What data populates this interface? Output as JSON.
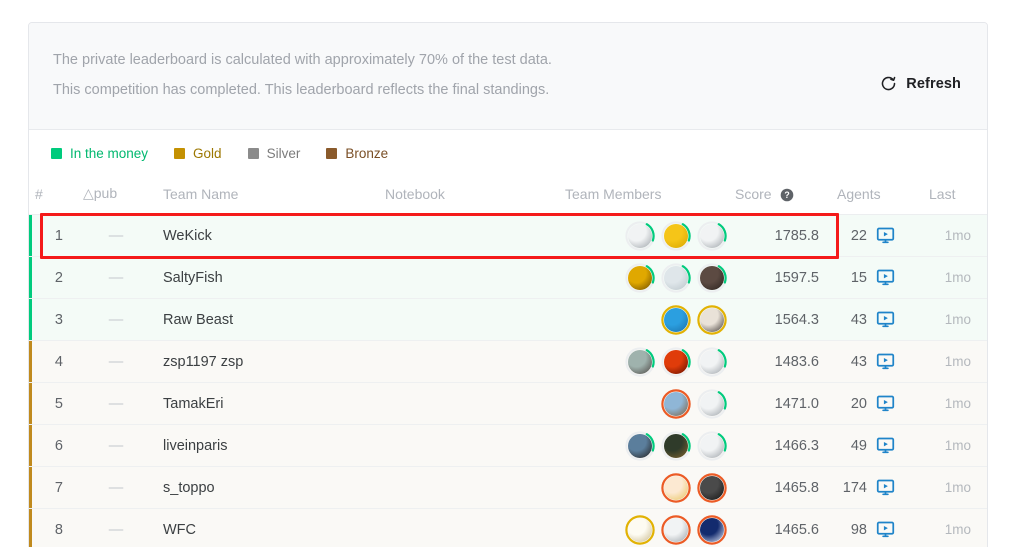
{
  "banner": {
    "line1": "The private leaderboard is calculated with approximately 70% of the test data.",
    "line2": "This competition has completed. This leaderboard reflects the final standings.",
    "refresh_label": "Refresh",
    "refresh_icon": "refresh-icon"
  },
  "legend": {
    "items": [
      {
        "label": "In the money",
        "color": "#00cb7d",
        "text_color": "#00b86f"
      },
      {
        "label": "Gold",
        "color": "#c49102",
        "text_color": "#9c7700"
      },
      {
        "label": "Silver",
        "color": "#8b8b8b",
        "text_color": "#7b7b7b"
      },
      {
        "label": "Bronze",
        "color": "#8a5a2b",
        "text_color": "#7a4f26"
      }
    ]
  },
  "table": {
    "headers": {
      "rank": "#",
      "delta": "△pub",
      "team": "Team Name",
      "notebook": "Notebook",
      "members": "Team Members",
      "score": "Score",
      "score_help_icon": "help-circle-icon",
      "agents": "Agents",
      "last": "Last"
    },
    "rows": [
      {
        "rank": "1",
        "delta": "—",
        "team": "WeKick",
        "notebook": "",
        "score": "1785.8",
        "agents": "22",
        "last": "1mo",
        "tier": "money",
        "stripe": "#00cb7d",
        "highlighted": true,
        "members": [
          {
            "ring": "#00cb7d",
            "arc": 0.22,
            "face_a": "#f1f3f4",
            "face_b": "#9aa0a6",
            "kind": "goose"
          },
          {
            "ring": "#00cb7d",
            "arc": 0.22,
            "face_a": "#f5c518",
            "face_b": "#d6a400",
            "kind": "pikachu"
          },
          {
            "ring": "#00cb7d",
            "arc": 0.22,
            "face_a": "#f1f3f4",
            "face_b": "#9aa0a6",
            "kind": "goose"
          }
        ]
      },
      {
        "rank": "2",
        "delta": "—",
        "team": "SaltyFish",
        "notebook": "",
        "score": "1597.5",
        "agents": "15",
        "last": "1mo",
        "tier": "money",
        "stripe": "#00cb7d",
        "highlighted": false,
        "members": [
          {
            "ring": "#00cb7d",
            "arc": 0.22,
            "face_a": "#e0a800",
            "face_b": "#6b4a00",
            "kind": "bottle"
          },
          {
            "ring": "#00cb7d",
            "arc": 0.22,
            "face_a": "#dfe6ea",
            "face_b": "#b9c4c9",
            "kind": "bird"
          },
          {
            "ring": "#00cb7d",
            "arc": 0.22,
            "face_a": "#5c4a42",
            "face_b": "#2a211d",
            "kind": "photo"
          }
        ]
      },
      {
        "rank": "3",
        "delta": "—",
        "team": "Raw Beast",
        "notebook": "",
        "score": "1564.3",
        "agents": "43",
        "last": "1mo",
        "tier": "money",
        "stripe": "#00cb7d",
        "highlighted": false,
        "members": [
          {
            "ring": "#e2b203",
            "arc": 1.0,
            "face_a": "#2b9fe0",
            "face_b": "#1b6fa8",
            "kind": "person"
          },
          {
            "ring": "#e2b203",
            "arc": 1.0,
            "face_a": "#e9e2d8",
            "face_b": "#3a3330",
            "kind": "person2"
          }
        ]
      },
      {
        "rank": "4",
        "delta": "—",
        "team": "zsp1197 zsp",
        "notebook": "",
        "score": "1483.6",
        "agents": "43",
        "last": "1mo",
        "tier": "gold",
        "stripe": "#c08a1e",
        "highlighted": false,
        "members": [
          {
            "ring": "#00cb7d",
            "arc": 0.22,
            "face_a": "#9fb2ad",
            "face_b": "#4a4340",
            "kind": "cat"
          },
          {
            "ring": "#00cb7d",
            "arc": 0.22,
            "face_a": "#e03c0a",
            "face_b": "#5c0d00",
            "kind": "fire"
          },
          {
            "ring": "#00cb7d",
            "arc": 0.22,
            "face_a": "#f1f3f4",
            "face_b": "#9aa0a6",
            "kind": "goose"
          }
        ]
      },
      {
        "rank": "5",
        "delta": "—",
        "team": "TamakEri",
        "notebook": "",
        "score": "1471.0",
        "agents": "20",
        "last": "1mo",
        "tier": "gold",
        "stripe": "#c08a1e",
        "highlighted": false,
        "members": [
          {
            "ring": "#ec5b25",
            "arc": 1.0,
            "face_a": "#8fb6d6",
            "face_b": "#7a5c3a",
            "kind": "scene"
          },
          {
            "ring": "#00cb7d",
            "arc": 0.22,
            "face_a": "#f1f3f4",
            "face_b": "#9aa0a6",
            "kind": "goose"
          }
        ]
      },
      {
        "rank": "6",
        "delta": "—",
        "team": "liveinparis",
        "notebook": "",
        "score": "1466.3",
        "agents": "49",
        "last": "1mo",
        "tier": "gold",
        "stripe": "#c08a1e",
        "highlighted": false,
        "members": [
          {
            "ring": "#00cb7d",
            "arc": 0.22,
            "face_a": "#5b7e9c",
            "face_b": "#1e1a18",
            "kind": "portrait"
          },
          {
            "ring": "#00cb7d",
            "arc": 0.22,
            "face_a": "#2f3b2a",
            "face_b": "#86662e",
            "kind": "scene2"
          },
          {
            "ring": "#00cb7d",
            "arc": 0.22,
            "face_a": "#f1f3f4",
            "face_b": "#9aa0a6",
            "kind": "goose"
          }
        ]
      },
      {
        "rank": "7",
        "delta": "—",
        "team": "s_toppo",
        "notebook": "",
        "score": "1465.8",
        "agents": "174",
        "last": "1mo",
        "tier": "gold",
        "stripe": "#c08a1e",
        "highlighted": false,
        "members": [
          {
            "ring": "#ec5b25",
            "arc": 1.0,
            "face_a": "#fce9d2",
            "face_b": "#e8c35a",
            "kind": "anime"
          },
          {
            "ring": "#ec5b25",
            "arc": 1.0,
            "face_a": "#4a4a4a",
            "face_b": "#111111",
            "kind": "dark"
          }
        ]
      },
      {
        "rank": "8",
        "delta": "—",
        "team": "WFC",
        "notebook": "",
        "score": "1465.6",
        "agents": "98",
        "last": "1mo",
        "tier": "gold",
        "stripe": "#c08a1e",
        "highlighted": false,
        "members": [
          {
            "ring": "#e2b203",
            "arc": 1.0,
            "face_a": "#fdfbf2",
            "face_b": "#c9b88a",
            "kind": "sketch"
          },
          {
            "ring": "#ec5b25",
            "arc": 1.0,
            "face_a": "#f1f3f4",
            "face_b": "#9aa0a6",
            "kind": "goose"
          },
          {
            "ring": "#ec5b25",
            "arc": 1.0,
            "face_a": "#132b6e",
            "face_b": "#eaf0ff",
            "kind": "logo"
          }
        ]
      }
    ]
  },
  "annotation": {
    "color": "#f41a1a",
    "target": "row-1-wekick"
  }
}
